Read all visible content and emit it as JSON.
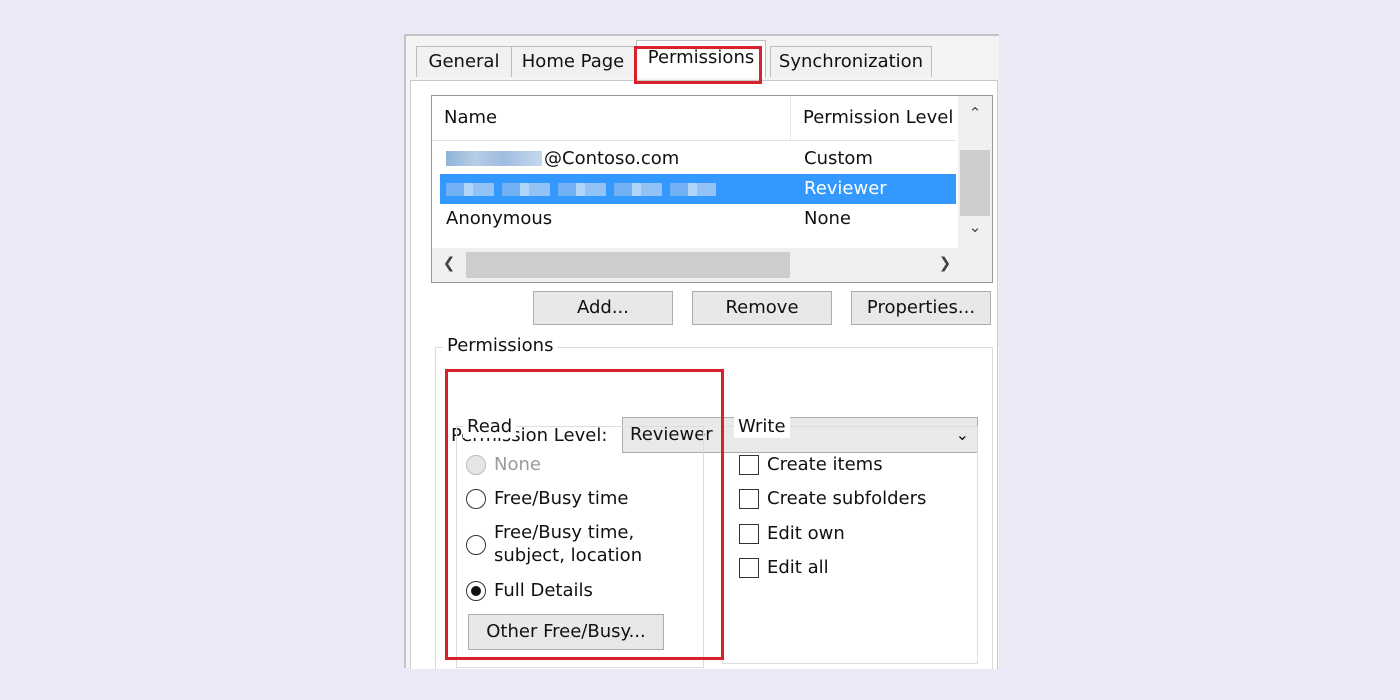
{
  "tabs": [
    {
      "label": "General"
    },
    {
      "label": "Home Page"
    },
    {
      "label": "Permissions"
    },
    {
      "label": "Synchronization"
    }
  ],
  "list": {
    "columns": {
      "name": "Name",
      "level": "Permission Level"
    },
    "rows": [
      {
        "name": "@Contoso.com",
        "level": "Custom"
      },
      {
        "name": "",
        "level": "Reviewer"
      },
      {
        "name": "Anonymous",
        "level": "None"
      }
    ]
  },
  "buttons": {
    "add": "Add...",
    "remove": "Remove",
    "properties": "Properties..."
  },
  "permissions": {
    "legend": "Permissions",
    "level_label": "Permission Level:",
    "level_value": "Reviewer",
    "read": {
      "legend": "Read",
      "options": [
        {
          "label": "None"
        },
        {
          "label": "Free/Busy time"
        },
        {
          "label": "Free/Busy time,"
        },
        {
          "label": "subject, location"
        },
        {
          "label": "Full Details"
        }
      ],
      "other_button": "Other Free/Busy..."
    },
    "write": {
      "legend": "Write",
      "options": [
        {
          "label": "Create items"
        },
        {
          "label": "Create subfolders"
        },
        {
          "label": "Edit own"
        },
        {
          "label": "Edit all"
        }
      ]
    }
  },
  "colors": {
    "selection": "#3399ff",
    "highlight": "#d9212c"
  }
}
